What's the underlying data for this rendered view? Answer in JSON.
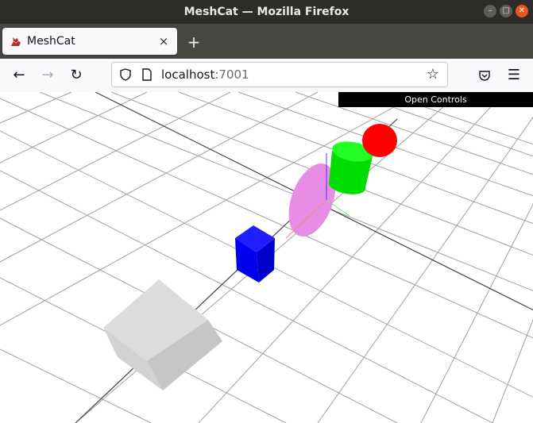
{
  "window": {
    "title": "MeshCat — Mozilla Firefox",
    "controls": [
      "–",
      "□",
      "✕"
    ]
  },
  "tabs": [
    {
      "title": "MeshCat",
      "close": "×",
      "favicon": "meshcat-cat-icon"
    }
  ],
  "new_tab_label": "+",
  "toolbar": {
    "back": "←",
    "forward": "→",
    "reload": "↻",
    "address": {
      "host": "localhost",
      "port": ":7001"
    },
    "bookmark": "☆",
    "pocket": "pocket-icon",
    "menu": "☰"
  },
  "viewer": {
    "open_controls_label": "Open Controls",
    "scene_objects": [
      {
        "name": "gray-box",
        "color": "#cfcfcf"
      },
      {
        "name": "blue-box",
        "color": "#0000ff"
      },
      {
        "name": "magenta-ellipsoid",
        "color": "#e88de6"
      },
      {
        "name": "green-cylinder",
        "color": "#00e000"
      },
      {
        "name": "red-sphere",
        "color": "#ff0000"
      }
    ]
  },
  "colors": {
    "titlebar": "#2d2c29",
    "tabstrip": "#474641",
    "active_tab": "#f9f9fb",
    "grid_line": "#999999"
  }
}
